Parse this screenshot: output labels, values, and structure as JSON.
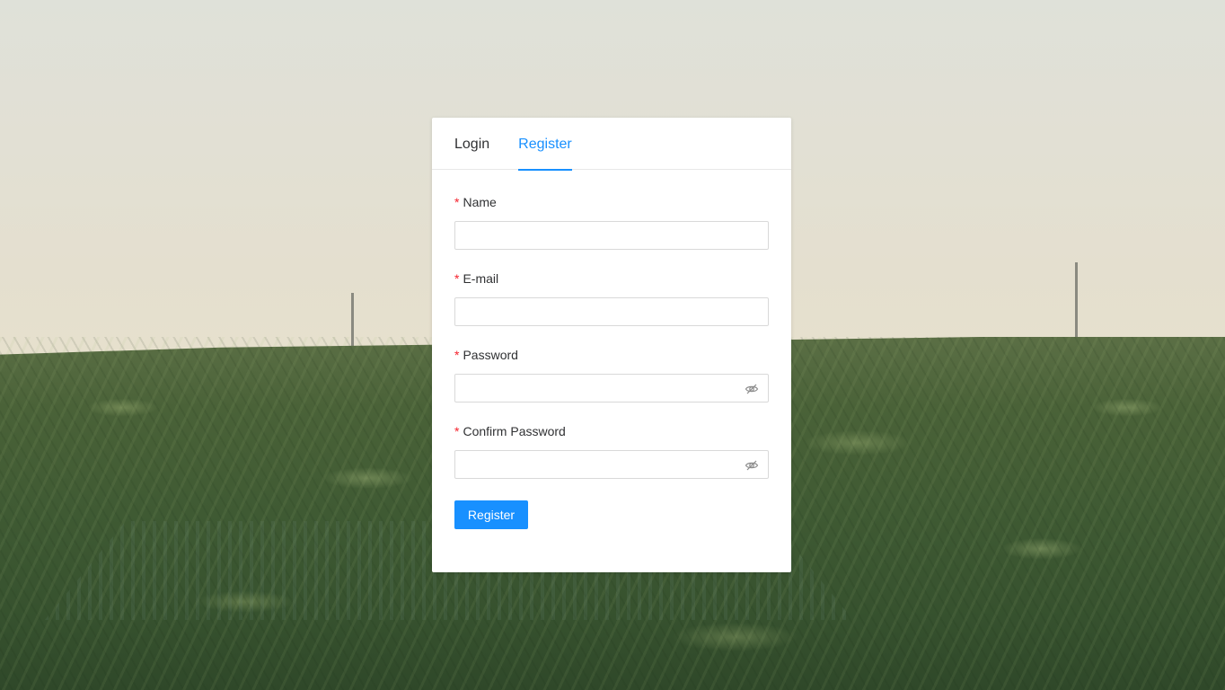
{
  "tabs": [
    {
      "label": "Login",
      "active": false
    },
    {
      "label": "Register",
      "active": true
    }
  ],
  "form": {
    "required_mark": "*",
    "name_label": "Name",
    "name_value": "",
    "email_label": "E-mail",
    "email_value": "",
    "password_label": "Password",
    "password_value": "",
    "confirm_label": "Confirm Password",
    "confirm_value": "",
    "submit_label": "Register"
  },
  "icons": {
    "password_toggle": "eye-invisible-icon",
    "confirm_toggle": "eye-invisible-icon"
  },
  "colors": {
    "accent": "#1890ff",
    "required": "#f5222d",
    "text": "#303133",
    "border": "#d9d9d9"
  }
}
